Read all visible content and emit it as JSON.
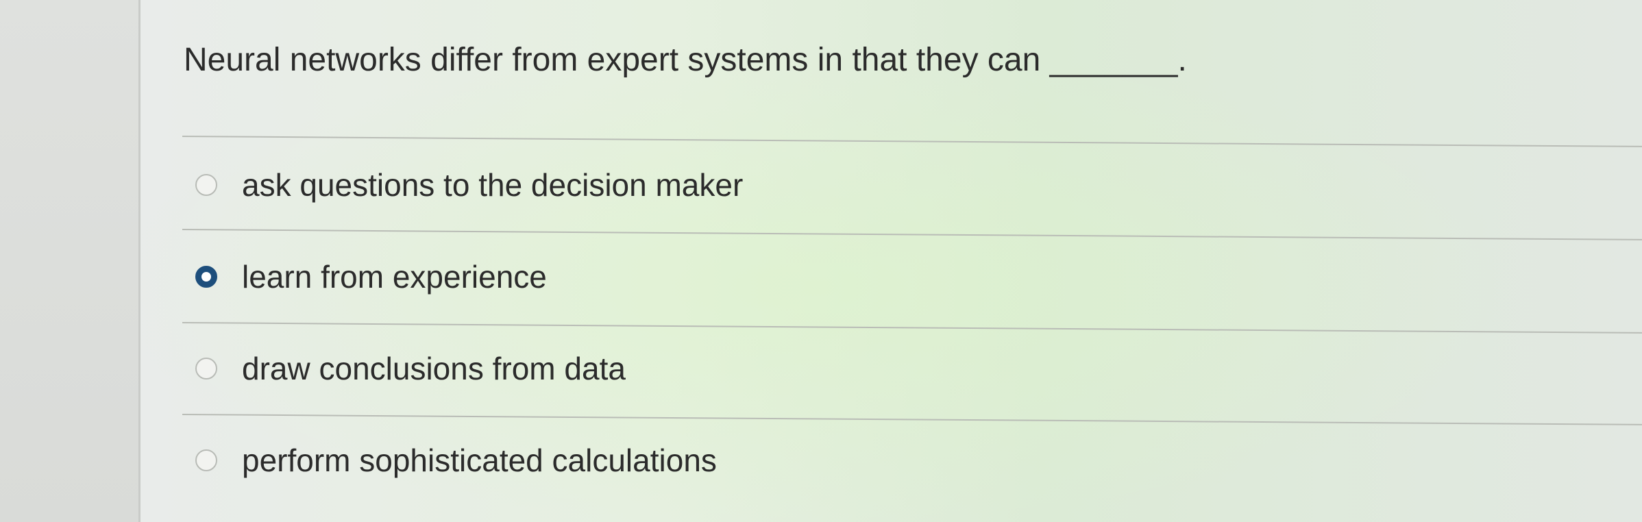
{
  "question": {
    "text": "Neural networks differ from expert systems in that they can _______."
  },
  "options": [
    {
      "label": "ask questions to the decision maker",
      "selected": false
    },
    {
      "label": "learn from experience",
      "selected": true
    },
    {
      "label": "draw conclusions from data",
      "selected": false
    },
    {
      "label": "perform sophisticated calculations",
      "selected": false
    }
  ],
  "colors": {
    "selected_radio": "#1d4e7c",
    "text": "#2b2b2b"
  }
}
